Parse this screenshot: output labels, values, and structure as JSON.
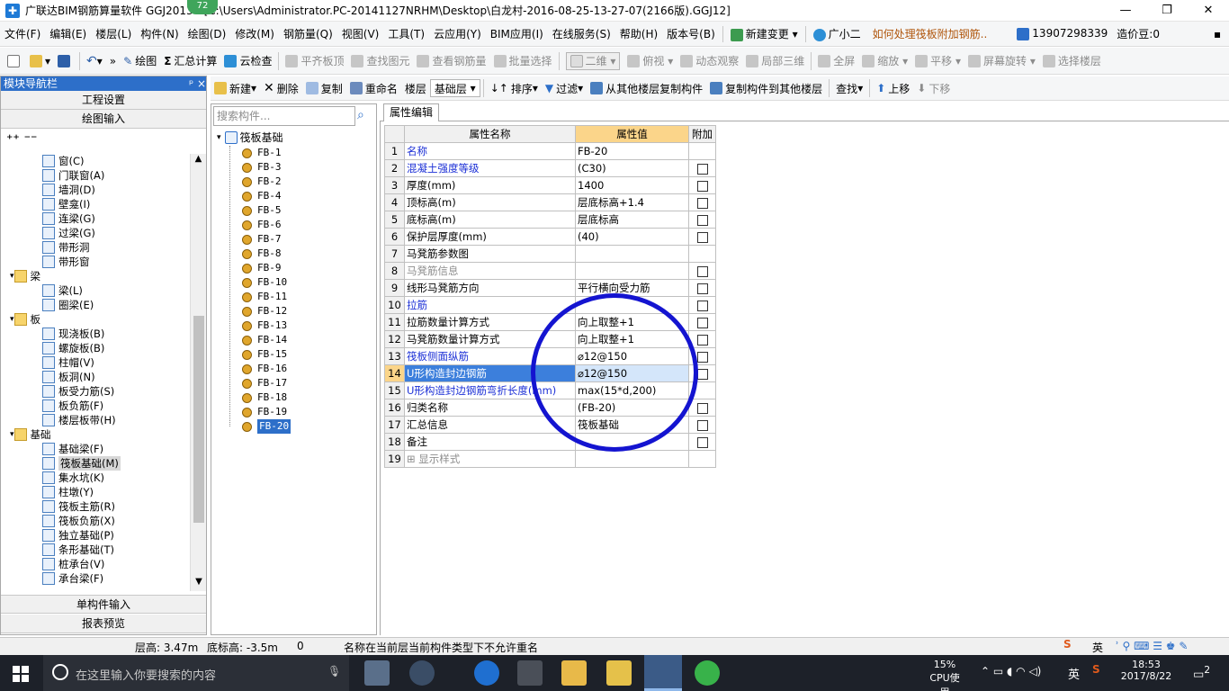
{
  "window": {
    "title": "广联达BIM钢筋算量软件 GGJ2013 - [C:\\Users\\Administrator.PC-20141127NRHM\\Desktop\\白龙村-2016-08-25-13-27-07(2166版).GGJ12]",
    "badge": "72",
    "minimize": "—",
    "maximize": "❐",
    "close": "✕"
  },
  "menu": {
    "items": [
      "文件(F)",
      "编辑(E)",
      "楼层(L)",
      "构件(N)",
      "绘图(D)",
      "修改(M)",
      "钢筋量(Q)",
      "视图(V)",
      "工具(T)",
      "云应用(Y)",
      "BIM应用(I)",
      "在线服务(S)",
      "帮助(H)",
      "版本号(B)"
    ],
    "new_change": "新建变更",
    "assistant": "广小二",
    "question": "如何处理筏板附加钢筋..",
    "phone": "13907298339",
    "cost_beans": "造价豆:0"
  },
  "toolbar": {
    "draw": "绘图",
    "sum_calc": "汇总计算",
    "cloud_check": "云检查",
    "flush_top": "平齐板顶",
    "find_elem": "查找图元",
    "view_rebar": "查看钢筋量",
    "batch_select": "批量选择",
    "view_mode": "二维",
    "top_view": "俯视",
    "dynamic_view": "动态观察",
    "local_3d": "局部三维",
    "fullscreen": "全屏",
    "zoom": "缩放",
    "pan": "平移",
    "screen_rotate": "屏幕旋转",
    "select_floor": "选择楼层"
  },
  "toolbar2": {
    "new": "新建",
    "delete": "删除",
    "copy": "复制",
    "rename": "重命名",
    "floor_label": "楼层",
    "floor_value": "基础层",
    "sort": "排序",
    "filter": "过滤",
    "copy_from": "从其他楼层复制构件",
    "copy_to": "复制构件到其他楼层",
    "find": "查找",
    "move_up": "上移",
    "move_down": "下移"
  },
  "leftnav": {
    "header": "模块导航栏",
    "pin": "ᵖ ×",
    "btn_project": "工程设置",
    "btn_draw": "绘图输入",
    "btn_single": "单构件输入",
    "btn_report": "报表预览",
    "tree": [
      {
        "label": "窗(C)",
        "cat": false
      },
      {
        "label": "门联窗(A)",
        "cat": false
      },
      {
        "label": "墙洞(D)",
        "cat": false
      },
      {
        "label": "壁龛(I)",
        "cat": false
      },
      {
        "label": "连梁(G)",
        "cat": false
      },
      {
        "label": "过梁(G)",
        "cat": false
      },
      {
        "label": "带形洞",
        "cat": false
      },
      {
        "label": "带形窗",
        "cat": false
      },
      {
        "label": "梁",
        "cat": true
      },
      {
        "label": "梁(L)",
        "cat": false
      },
      {
        "label": "圈梁(E)",
        "cat": false
      },
      {
        "label": "板",
        "cat": true
      },
      {
        "label": "现浇板(B)",
        "cat": false
      },
      {
        "label": "螺旋板(B)",
        "cat": false
      },
      {
        "label": "柱帽(V)",
        "cat": false
      },
      {
        "label": "板洞(N)",
        "cat": false
      },
      {
        "label": "板受力筋(S)",
        "cat": false
      },
      {
        "label": "板负筋(F)",
        "cat": false
      },
      {
        "label": "楼层板带(H)",
        "cat": false
      },
      {
        "label": "基础",
        "cat": true
      },
      {
        "label": "基础梁(F)",
        "cat": false
      },
      {
        "label": "筏板基础(M)",
        "cat": false
      },
      {
        "label": "集水坑(K)",
        "cat": false
      },
      {
        "label": "柱墩(Y)",
        "cat": false
      },
      {
        "label": "筏板主筋(R)",
        "cat": false
      },
      {
        "label": "筏板负筋(X)",
        "cat": false
      },
      {
        "label": "独立基础(P)",
        "cat": false
      },
      {
        "label": "条形基础(T)",
        "cat": false
      },
      {
        "label": "桩承台(V)",
        "cat": false
      },
      {
        "label": "承台梁(F)",
        "cat": false
      }
    ]
  },
  "midtree": {
    "search_placeholder": "搜索构件...",
    "root": "筏板基础",
    "items": [
      "FB-1",
      "FB-3",
      "FB-2",
      "FB-4",
      "FB-5",
      "FB-6",
      "FB-7",
      "FB-8",
      "FB-9",
      "FB-10",
      "FB-11",
      "FB-12",
      "FB-13",
      "FB-14",
      "FB-15",
      "FB-16",
      "FB-17",
      "FB-18",
      "FB-19",
      "FB-20"
    ]
  },
  "props": {
    "tab": "属性编辑",
    "col_name": "属性名称",
    "col_value": "属性值",
    "col_add": "附加",
    "rows": [
      {
        "n": "1",
        "name": "名称",
        "value": "FB-20",
        "style": "blue",
        "chk": false
      },
      {
        "n": "2",
        "name": "混凝土强度等级",
        "value": "(C30)",
        "style": "blue",
        "chk": true
      },
      {
        "n": "3",
        "name": "厚度(mm)",
        "value": "1400",
        "style": "",
        "chk": true
      },
      {
        "n": "4",
        "name": "顶标高(m)",
        "value": "层底标高+1.4",
        "style": "",
        "chk": true
      },
      {
        "n": "5",
        "name": "底标高(m)",
        "value": "层底标高",
        "style": "",
        "chk": true
      },
      {
        "n": "6",
        "name": "保护层厚度(mm)",
        "value": "(40)",
        "style": "",
        "chk": true
      },
      {
        "n": "7",
        "name": "马凳筋参数图",
        "value": "",
        "style": "",
        "chk": false
      },
      {
        "n": "8",
        "name": "马凳筋信息",
        "value": "",
        "style": "gray",
        "chk": true
      },
      {
        "n": "9",
        "name": "线形马凳筋方向",
        "value": "平行横向受力筋",
        "style": "",
        "chk": true
      },
      {
        "n": "10",
        "name": "拉筋",
        "value": "",
        "style": "blue",
        "chk": true
      },
      {
        "n": "11",
        "name": "拉筋数量计算方式",
        "value": "向上取整+1",
        "style": "",
        "chk": true
      },
      {
        "n": "12",
        "name": "马凳筋数量计算方式",
        "value": "向上取整+1",
        "style": "",
        "chk": true
      },
      {
        "n": "13",
        "name": "筏板侧面纵筋",
        "value": "⌀12@150",
        "style": "blue",
        "chk": true
      },
      {
        "n": "14",
        "name": "U形构造封边钢筋",
        "value": "⌀12@150",
        "style": "sel",
        "chk": true
      },
      {
        "n": "15",
        "name": "U形构造封边钢筋弯折长度(mm)",
        "value": "max(15*d,200)",
        "style": "blue",
        "chk": false
      },
      {
        "n": "16",
        "name": "归类名称",
        "value": "(FB-20)",
        "style": "",
        "chk": true
      },
      {
        "n": "17",
        "name": "汇总信息",
        "value": "筏板基础",
        "style": "",
        "chk": true
      },
      {
        "n": "18",
        "name": "备注",
        "value": "",
        "style": "",
        "chk": true
      },
      {
        "n": "19",
        "name": "显示样式",
        "value": "",
        "style": "gray",
        "chk": false
      }
    ]
  },
  "status": {
    "floor_height": "层高: 3.47m",
    "bottom_elev": "底标高: -3.5m",
    "zero": "0",
    "message": "名称在当前层当前构件类型下不允许重名"
  },
  "taskbar": {
    "search_placeholder": "在这里输入你要搜索的内容",
    "cpu_pct": "15%",
    "cpu_label": "CPU使用",
    "ime": "英",
    "time": "18:53",
    "date": "2017/8/22",
    "notif": "2"
  },
  "colors": {
    "accent_blue": "#2d6fc9",
    "header_orange": "#fbd58a",
    "circle": "#1414d0"
  }
}
